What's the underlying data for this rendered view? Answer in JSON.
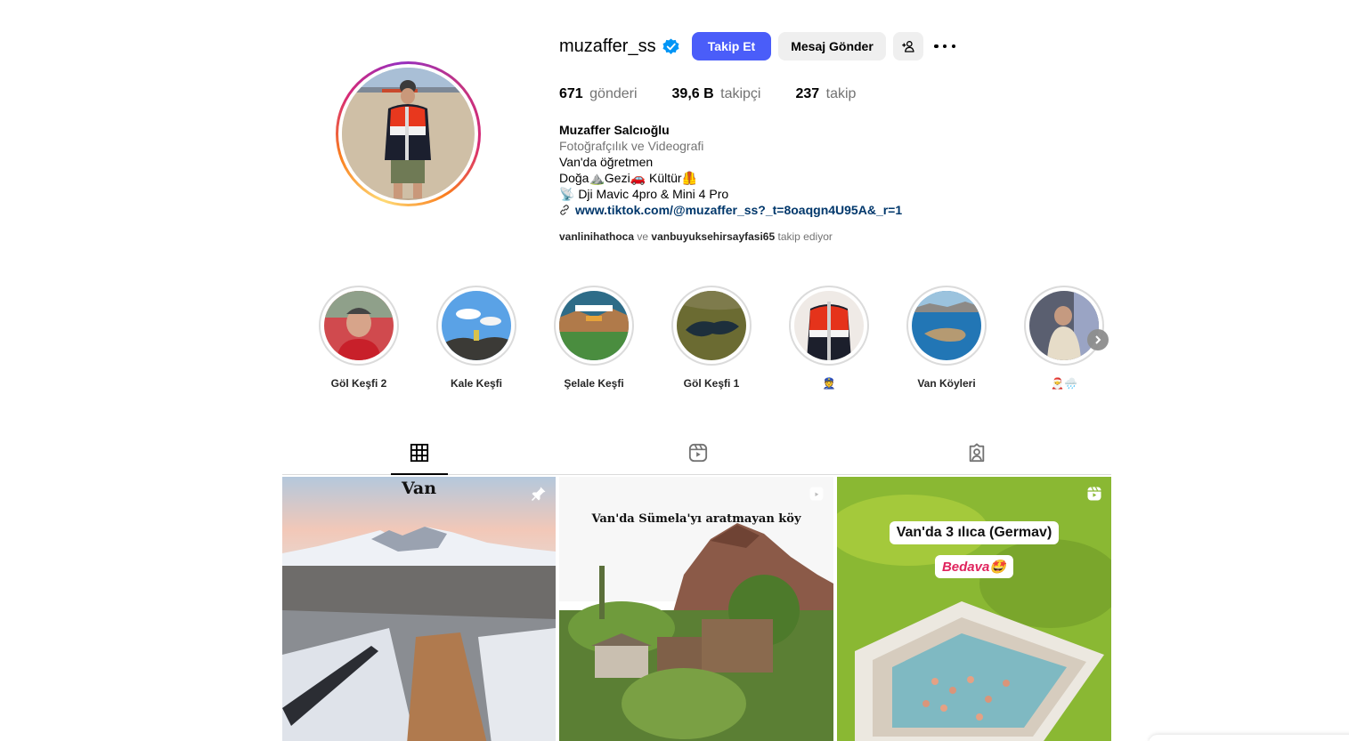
{
  "profile": {
    "username": "muzaffer_ss",
    "follow_label": "Takip Et",
    "message_label": "Mesaj Gönder",
    "stats": {
      "posts_value": "671",
      "posts_label": "gönderi",
      "followers_value": "39,6 B",
      "followers_label": "takipçi",
      "following_value": "237",
      "following_label": "takip"
    },
    "bio": {
      "name": "Muzaffer Salcıoğlu",
      "category": "Fotoğrafçılık ve Videografi",
      "line1": "Van'da öğretmen",
      "line2": "Doğa⛰️Gezi🚗 Kültür🦺",
      "line3": "📡 Dji Mavic 4pro & Mini 4 Pro",
      "link": "www.tiktok.com/@muzaffer_ss?_t=8oaqgn4U95A&_r=1"
    },
    "mutual": {
      "user1": "vanlinihathoca",
      "and": "ve",
      "user2": "vanbuyuksehirsayfasi65",
      "suffix": "takip ediyor"
    }
  },
  "highlights": [
    {
      "label": "Göl Keşfi 2"
    },
    {
      "label": "Kale Keşfi"
    },
    {
      "label": "Şelale Keşfi"
    },
    {
      "label": "Göl Keşfi 1"
    },
    {
      "label": "👮"
    },
    {
      "label": "Van Köyleri"
    },
    {
      "label": "🎅🌧️"
    }
  ],
  "tabs": [
    "grid-icon",
    "reels-icon",
    "tagged-icon"
  ],
  "posts": [
    {
      "title": "Van",
      "icon": "pin-icon"
    },
    {
      "title": "Van'da  Sümela'yı aratmayan köy",
      "icon": "reel-icon"
    },
    {
      "title": "Van'da 3 ılıca (Germav)",
      "subtitle": "Bedava🤩",
      "icon": "reel-icon"
    }
  ],
  "colors": {
    "follow_button": "#4a5df9",
    "secondary_button": "#efefef",
    "link": "#00376b",
    "verified": "#0095f6"
  }
}
